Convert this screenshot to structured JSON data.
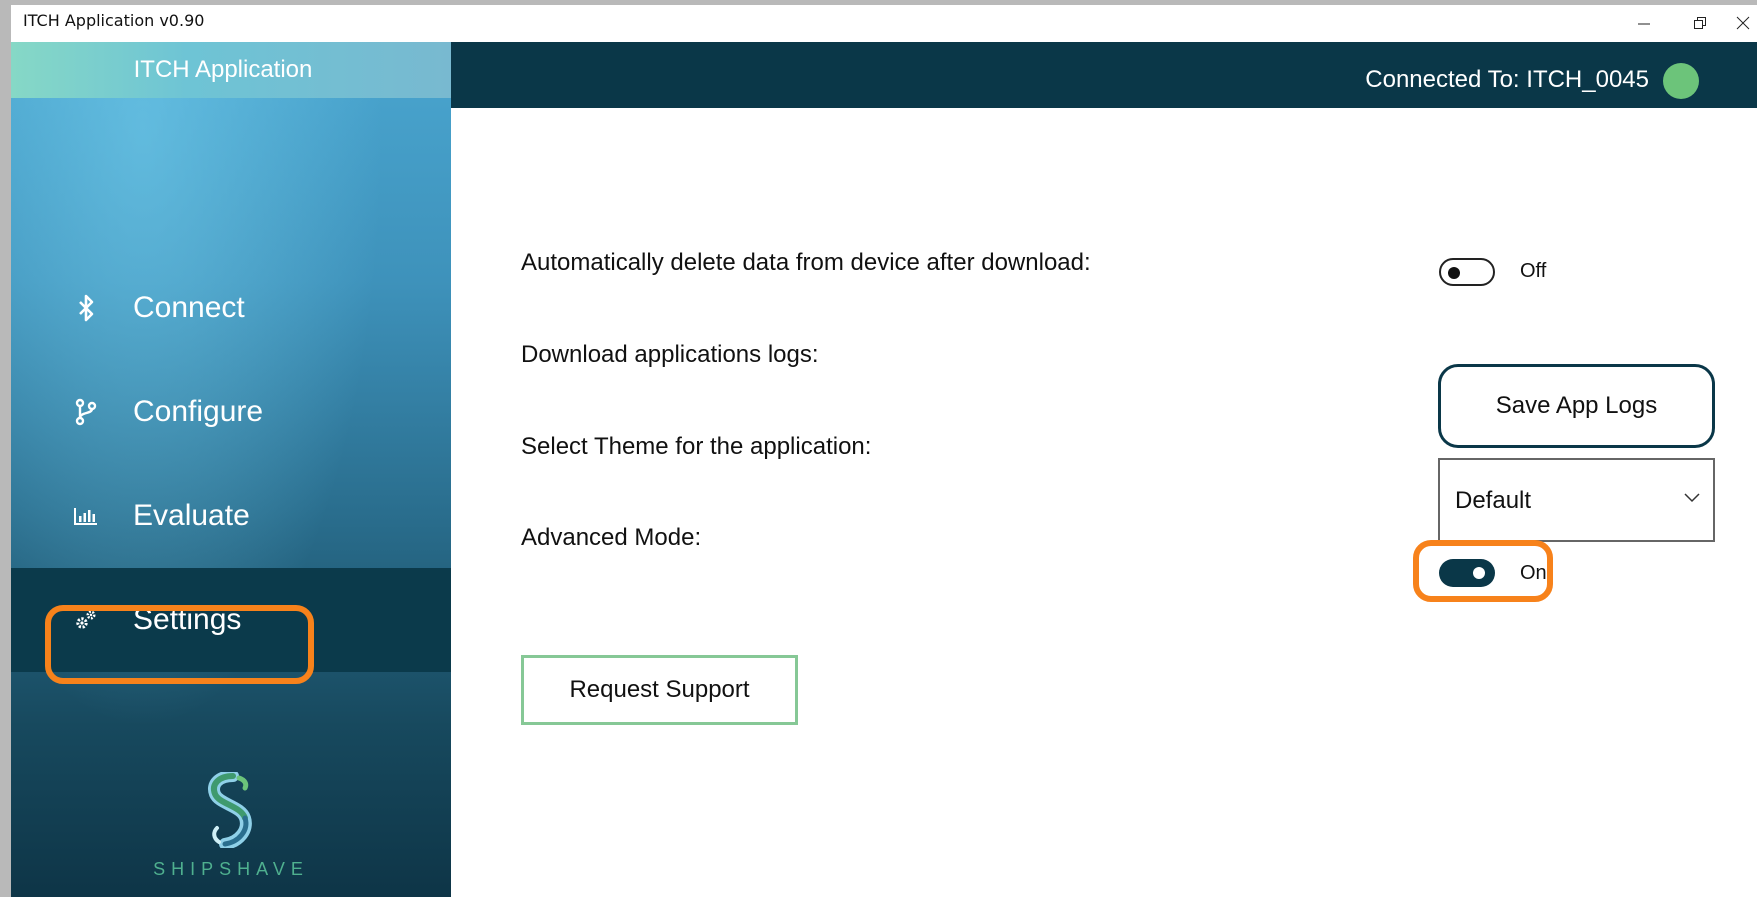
{
  "window": {
    "title": "ITCH Application v0.90"
  },
  "sidebar": {
    "app_title": "ITCH Application",
    "items": [
      {
        "label": "Connect",
        "icon": "bluetooth-icon"
      },
      {
        "label": "Configure",
        "icon": "branch-icon"
      },
      {
        "label": "Evaluate",
        "icon": "bar-chart-icon"
      },
      {
        "label": "Settings",
        "icon": "gears-icon",
        "active": true
      }
    ],
    "brand": "SHIPSHAVE"
  },
  "topbar": {
    "connection_text": "Connected To: ITCH_0045",
    "status_color": "#6cc47a"
  },
  "settings": {
    "auto_delete": {
      "label": "Automatically delete data from device after download:",
      "state": "Off",
      "enabled": false
    },
    "download_logs": {
      "label": "Download applications logs:",
      "button": "Save App Logs"
    },
    "theme": {
      "label": "Select Theme for the application:",
      "selected": "Default"
    },
    "advanced_mode": {
      "label": "Advanced Mode:",
      "state": "On",
      "enabled": true
    },
    "support_button": "Request Support"
  },
  "colors": {
    "accent_dark": "#0a3748",
    "highlight": "#f7821b",
    "support_border": "#86c896"
  }
}
